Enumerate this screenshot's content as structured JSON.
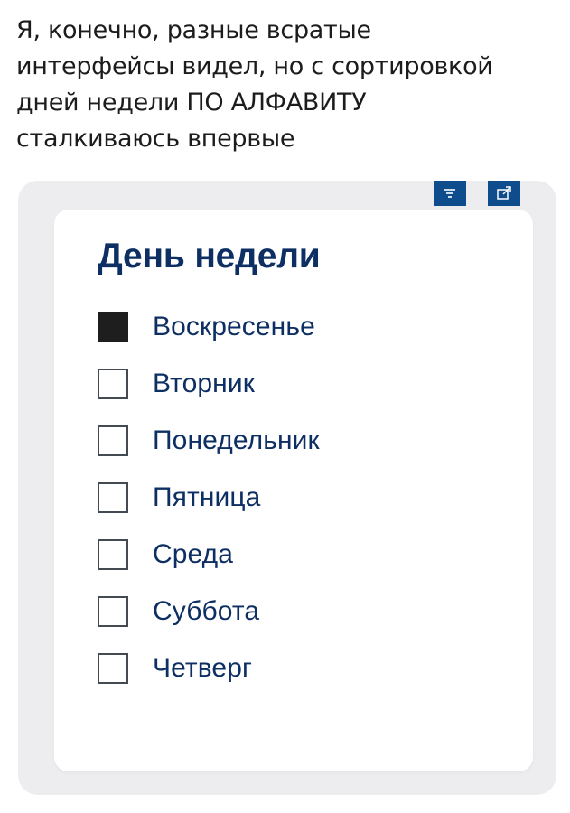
{
  "caption": {
    "lines": [
      "Я, конечно, разные всратые",
      "интерфейсы видел, но с сортировкой",
      "дней недели ПО АЛФАВИТУ",
      "сталкиваюсь впервые"
    ]
  },
  "toolbar": {
    "filter_icon": "filter-icon",
    "expand_icon": "expand-icon",
    "button_color": "#0f4c8c"
  },
  "filter": {
    "title": "День недели",
    "items": [
      {
        "label": "Воскресенье",
        "checked": true
      },
      {
        "label": "Вторник",
        "checked": false
      },
      {
        "label": "Понедельник",
        "checked": false
      },
      {
        "label": "Пятница",
        "checked": false
      },
      {
        "label": "Среда",
        "checked": false
      },
      {
        "label": "Суббота",
        "checked": false
      },
      {
        "label": "Четверг",
        "checked": false
      }
    ]
  },
  "colors": {
    "title": "#0d2f63",
    "checked_fill": "#1e1e1e"
  }
}
